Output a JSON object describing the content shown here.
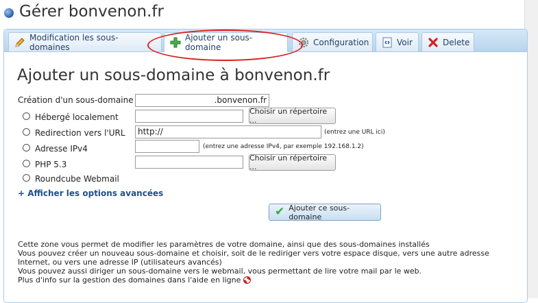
{
  "header": {
    "title": "Gérer bonvenon.fr",
    "icon": "globe-icon"
  },
  "tabs": [
    {
      "label": "Modification les sous-domaines",
      "icon": "pencil-icon",
      "active": false
    },
    {
      "label": "Ajouter un sous-domaine",
      "icon": "plus-icon",
      "active": true
    },
    {
      "label": "Configuration",
      "icon": "gear-icon",
      "active": false
    },
    {
      "label": "Voir",
      "icon": "view-icon",
      "active": false
    },
    {
      "label": "Delete",
      "icon": "delete-icon",
      "active": false
    }
  ],
  "colors": {
    "highlight": "#d81f1f",
    "link": "#1f4f8a",
    "plus": "#3aa53a",
    "delete": "#d42020"
  },
  "form": {
    "heading": "Ajouter un sous-domaine à bonvenon.fr",
    "subdomain_label": "Création d'un sous-domaine :",
    "subdomain_value": "",
    "domain_suffix": ".bonvenon.fr",
    "options": [
      {
        "label": "Hébergé localement",
        "value": "",
        "button": "Choisir un répertoire ..."
      },
      {
        "label": "Redirection vers l'URL",
        "value": "http://",
        "hint": "(entrez une URL ici)"
      },
      {
        "label": "Adresse IPv4",
        "value": "",
        "hint": "(entrez une adresse IPv4, par exemple 192.168.1.2)"
      },
      {
        "label": "PHP 5.3",
        "value": "",
        "button": "Choisir un répertoire ..."
      },
      {
        "label": "Roundcube Webmail"
      }
    ],
    "advanced_link": "+ Afficher les options avancées",
    "submit": "Ajouter ce sous-domaine"
  },
  "info": {
    "lines": [
      "Cette zone vous permet de modifier les paramètres de votre domaine, ainsi que des sous-domaines installés",
      "Vous pouvez créer un nouveau sous-domaine et choisir, soit de le rediriger vers votre espace disque, vers une autre adresse Internet, ou vers une adresse IP (utilisateurs avancés)",
      "Vous pouvez aussi diriger un sous-domaine vers le webmail, vous permettant de lire votre mail par le web."
    ],
    "help_text": "Plus d'info sur la gestion des domaines dans l'aide en ligne",
    "help_icon": "lifebuoy-icon"
  }
}
